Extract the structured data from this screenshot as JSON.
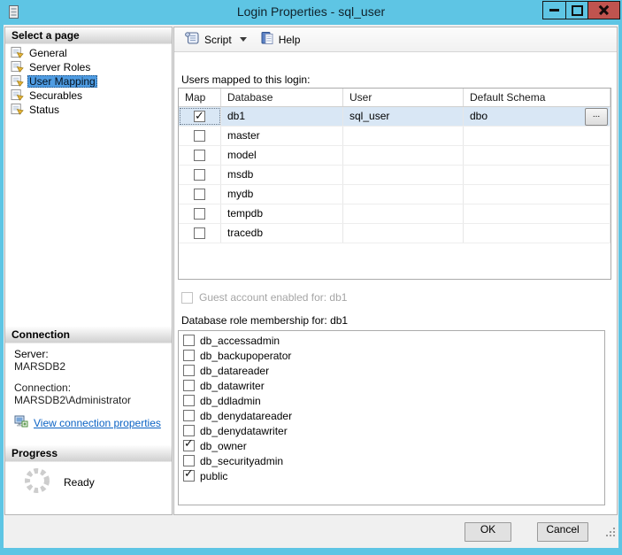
{
  "window": {
    "title": "Login Properties - sql_user"
  },
  "sidebar": {
    "select_page_header": "Select a page",
    "pages": [
      {
        "label": "General",
        "selected": false
      },
      {
        "label": "Server Roles",
        "selected": false
      },
      {
        "label": "User Mapping",
        "selected": true
      },
      {
        "label": "Securables",
        "selected": false
      },
      {
        "label": "Status",
        "selected": false
      }
    ],
    "connection_header": "Connection",
    "server_label": "Server:",
    "server_value": "MARSDB2",
    "connection_label": "Connection:",
    "connection_value": "MARSDB2\\Administrator",
    "view_connection_link": "View connection properties",
    "progress_header": "Progress",
    "progress_status": "Ready"
  },
  "toolbar": {
    "script_label": "Script",
    "help_label": "Help"
  },
  "main": {
    "users_mapped_label": "Users mapped to this login:",
    "table": {
      "headers": [
        "Map",
        "Database",
        "User",
        "Default Schema"
      ],
      "rows": [
        {
          "map": true,
          "database": "db1",
          "user": "sql_user",
          "default_schema": "dbo",
          "selected": true
        },
        {
          "map": false,
          "database": "master",
          "user": "",
          "default_schema": "",
          "selected": false
        },
        {
          "map": false,
          "database": "model",
          "user": "",
          "default_schema": "",
          "selected": false
        },
        {
          "map": false,
          "database": "msdb",
          "user": "",
          "default_schema": "",
          "selected": false
        },
        {
          "map": false,
          "database": "mydb",
          "user": "",
          "default_schema": "",
          "selected": false
        },
        {
          "map": false,
          "database": "tempdb",
          "user": "",
          "default_schema": "",
          "selected": false
        },
        {
          "map": false,
          "database": "tracedb",
          "user": "",
          "default_schema": "",
          "selected": false
        }
      ]
    },
    "browse_button": "...",
    "guest_account_label": "Guest account enabled for: db1",
    "guest_account_checked": false,
    "role_membership_label": "Database role membership for: db1",
    "roles": [
      {
        "name": "db_accessadmin",
        "checked": false
      },
      {
        "name": "db_backupoperator",
        "checked": false
      },
      {
        "name": "db_datareader",
        "checked": false
      },
      {
        "name": "db_datawriter",
        "checked": false
      },
      {
        "name": "db_ddladmin",
        "checked": false
      },
      {
        "name": "db_denydatareader",
        "checked": false
      },
      {
        "name": "db_denydatawriter",
        "checked": false
      },
      {
        "name": "db_owner",
        "checked": true
      },
      {
        "name": "db_securityadmin",
        "checked": false
      },
      {
        "name": "public",
        "checked": true
      }
    ]
  },
  "footer": {
    "ok": "OK",
    "cancel": "Cancel"
  },
  "colors": {
    "titlebar_bg": "#5ec5e4",
    "close_button_bg": "#c0544f",
    "sidebar_selection_bg": "#4f9ce2",
    "selected_row_bg": "#d9e7f5",
    "link_color": "#0a62c4",
    "dialog_bg": "#f0f0f0"
  }
}
